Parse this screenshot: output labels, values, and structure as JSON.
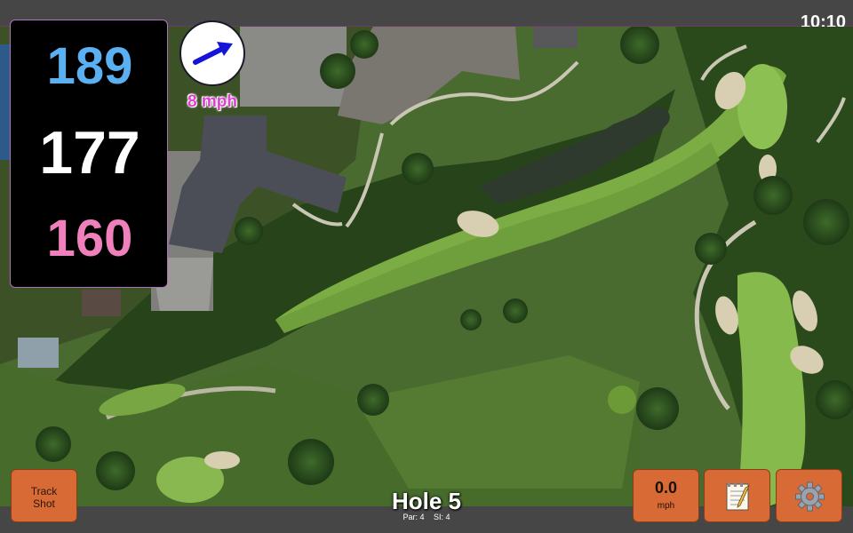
{
  "status": {
    "time": "10:10"
  },
  "distances": {
    "back": "189",
    "middle": "177",
    "front": "160"
  },
  "wind": {
    "speed_label": "8 mph",
    "arrow_icon": "arrow-right-icon"
  },
  "buttons": {
    "track_shot": "Track\nShot",
    "wind_value": "0.0",
    "wind_unit": "mph",
    "notes_icon": "notepad-icon",
    "settings_icon": "gear-icon"
  },
  "hole": {
    "title": "Hole 5",
    "par": "Par: 4",
    "si": "SI: 4"
  },
  "colors": {
    "back": "#5ab0f0",
    "middle": "#ffffff",
    "front": "#f080bc",
    "button": "#d86a35",
    "wind_text": "#e040d0"
  }
}
